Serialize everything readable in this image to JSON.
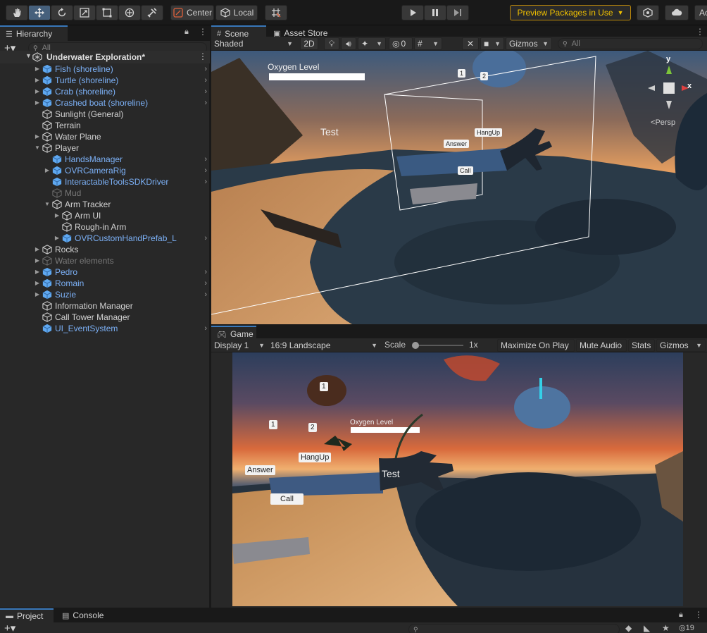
{
  "toolbar": {
    "pivot_label": "Center",
    "space_label": "Local",
    "preview_label": "Preview Packages in Use",
    "account_label": "Ac"
  },
  "hierarchy": {
    "tab_label": "Hierarchy",
    "search_placeholder": "All",
    "scene_name": "Underwater Exploration*",
    "items": [
      {
        "label": "Fish (shoreline)"
      },
      {
        "label": "Turtle (shoreline)"
      },
      {
        "label": "Crab (shoreline)"
      },
      {
        "label": "Crashed boat (shoreline)"
      },
      {
        "label": "Sunlight (General)"
      },
      {
        "label": "Terrain"
      },
      {
        "label": "Water Plane"
      },
      {
        "label": "Player"
      },
      {
        "label": "HandsManager"
      },
      {
        "label": "OVRCameraRig"
      },
      {
        "label": "InteractableToolsSDKDriver"
      },
      {
        "label": "Mud"
      },
      {
        "label": "Arm Tracker"
      },
      {
        "label": "Arm UI"
      },
      {
        "label": "Rough-in Arm"
      },
      {
        "label": "OVRCustomHandPrefab_L"
      },
      {
        "label": "Rocks"
      },
      {
        "label": "Water elements"
      },
      {
        "label": "Pedro"
      },
      {
        "label": "Romain"
      },
      {
        "label": "Suzie"
      },
      {
        "label": "Information Manager"
      },
      {
        "label": "Call Tower Manager"
      },
      {
        "label": "UI_EventSystem"
      }
    ]
  },
  "scene": {
    "tab_label": "Scene",
    "asset_store_label": "Asset Store",
    "shading_mode": "Shaded",
    "mode_2d": "2D",
    "hidden_count": "0",
    "gizmos_label": "Gizmos",
    "search_placeholder": "All",
    "persp_label": "Persp",
    "axis_y": "y",
    "axis_x": "x",
    "oxygen_label": "Oxygen Level",
    "test_label": "Test",
    "btn_1": "1",
    "btn_2": "2",
    "answer_label": "Answer",
    "hangup_label": "HangUp",
    "call_label": "Call"
  },
  "game": {
    "tab_label": "Game",
    "display": "Display 1",
    "aspect": "16:9 Landscape",
    "scale_label": "Scale",
    "scale_value": "1x",
    "maximize_label": "Maximize On Play",
    "mute_label": "Mute Audio",
    "stats_label": "Stats",
    "gizmos_label": "Gizmos",
    "oxygen_label": "Oxygen Level",
    "test_label": "Test",
    "btn_1": "1",
    "btn_2": "2",
    "answer_label": "Answer",
    "hangup_label": "HangUp",
    "call_label": "Call",
    "token_label": "1"
  },
  "bottom": {
    "project_label": "Project",
    "console_label": "Console",
    "hidden_count": "19"
  }
}
